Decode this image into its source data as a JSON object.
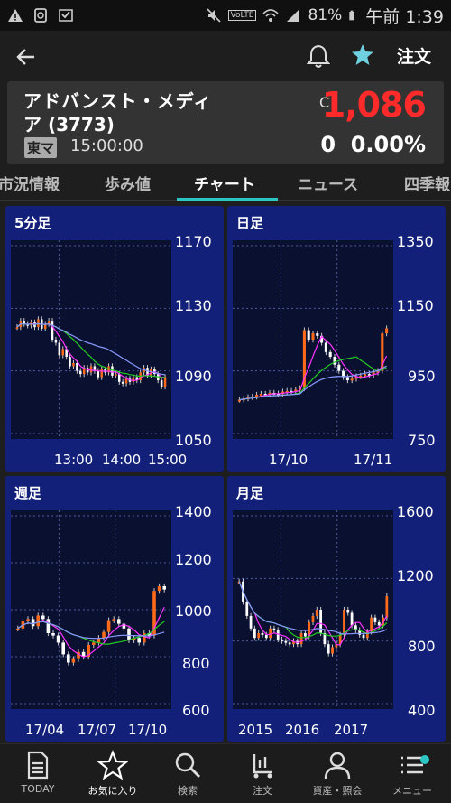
{
  "status_bar": {
    "battery": "81%",
    "time": "午前 1:39",
    "volte": "VoLTE"
  },
  "header": {
    "order_label": "注文"
  },
  "stock": {
    "name_line1": "アドバンスト・メディ",
    "name_line2": "ア (3773)",
    "market": "東マ",
    "time": "15:00:00",
    "price_prefix": "C",
    "price": "1,086",
    "change": "0",
    "change_pct": "0.00%"
  },
  "tabs": [
    "市況情報",
    "歩み値",
    "チャート",
    "ニュース",
    "四季報"
  ],
  "active_tab": "チャート",
  "colors": {
    "up": "#ff6a1a",
    "down": "#ffffff",
    "ma_short": "#ff33ff",
    "ma_mid": "#22cc22",
    "ma_long": "#8899ff",
    "panel": "#13207a",
    "accent": "#2ec5c5",
    "price": "#ff2a2a"
  },
  "charts": [
    {
      "title": "5分足",
      "y_ticks": [
        "1170",
        "1130",
        "1090",
        "1050"
      ],
      "x_ticks": [
        "13:00",
        "14:00",
        "15:00"
      ]
    },
    {
      "title": "日足",
      "y_ticks": [
        "1350",
        "1150",
        "950",
        "750"
      ],
      "x_ticks": [
        "17/10",
        "17/11"
      ]
    },
    {
      "title": "週足",
      "y_ticks": [
        "1400",
        "1200",
        "1000",
        "800",
        "600"
      ],
      "x_ticks": [
        "17/04",
        "17/07",
        "17/10"
      ]
    },
    {
      "title": "月足",
      "y_ticks": [
        "1600",
        "1200",
        "800",
        "400"
      ],
      "x_ticks": [
        "2015",
        "2016",
        "2017"
      ]
    }
  ],
  "chart_data": [
    {
      "type": "candlestick",
      "title": "5分足",
      "ylim": [
        1050,
        1170
      ],
      "x_ticks": [
        "13:00",
        "14:00",
        "15:00"
      ],
      "close": [
        1118,
        1122,
        1120,
        1119,
        1121,
        1118,
        1123,
        1117,
        1120,
        1122,
        1110,
        1108,
        1100,
        1104,
        1099,
        1093,
        1095,
        1090,
        1088,
        1092,
        1089,
        1093,
        1090,
        1086,
        1091,
        1089,
        1093,
        1087,
        1088,
        1083,
        1082,
        1085,
        1083,
        1086,
        1084,
        1089,
        1092,
        1087,
        1091,
        1088,
        1084,
        1080,
        1086
      ]
    },
    {
      "type": "candlestick",
      "title": "日足",
      "ylim": [
        750,
        1350
      ],
      "x_ticks": [
        "17/10",
        "17/11"
      ],
      "close": [
        858,
        862,
        866,
        868,
        874,
        877,
        875,
        880,
        878,
        876,
        884,
        886,
        883,
        890,
        895,
        1080,
        1050,
        1070,
        1062,
        1040,
        1010,
        995,
        970,
        950,
        930,
        920,
        925,
        933,
        935,
        940,
        938,
        945,
        950,
        1070,
        1086
      ]
    },
    {
      "type": "candlestick",
      "title": "週足",
      "ylim": [
        600,
        1400
      ],
      "x_ticks": [
        "17/04",
        "17/07",
        "17/10"
      ],
      "close": [
        920,
        950,
        960,
        930,
        975,
        960,
        900,
        890,
        860,
        810,
        775,
        790,
        820,
        800,
        850,
        860,
        880,
        905,
        955,
        960,
        940,
        920,
        870,
        880,
        860,
        900,
        890,
        1080,
        1100,
        1086
      ]
    },
    {
      "type": "candlestick",
      "title": "月足",
      "ylim": [
        400,
        1600
      ],
      "x_ticks": [
        "2015",
        "2016",
        "2017"
      ],
      "close": [
        1180,
        1050,
        960,
        880,
        820,
        850,
        840,
        820,
        880,
        870,
        810,
        800,
        790,
        780,
        800,
        780,
        850,
        830,
        920,
        960,
        1000,
        850,
        780,
        720,
        760,
        780,
        840,
        1000,
        980,
        900,
        870,
        840,
        820,
        860,
        950,
        920,
        900,
        950,
        1086
      ]
    }
  ],
  "nav": [
    {
      "label": "TODAY",
      "icon": "document-icon"
    },
    {
      "label": "お気に入り",
      "icon": "star-icon"
    },
    {
      "label": "検索",
      "icon": "search-icon"
    },
    {
      "label": "注文",
      "icon": "cart-icon"
    },
    {
      "label": "資産・照会",
      "icon": "person-icon"
    },
    {
      "label": "メニュー",
      "icon": "menu-icon"
    }
  ]
}
